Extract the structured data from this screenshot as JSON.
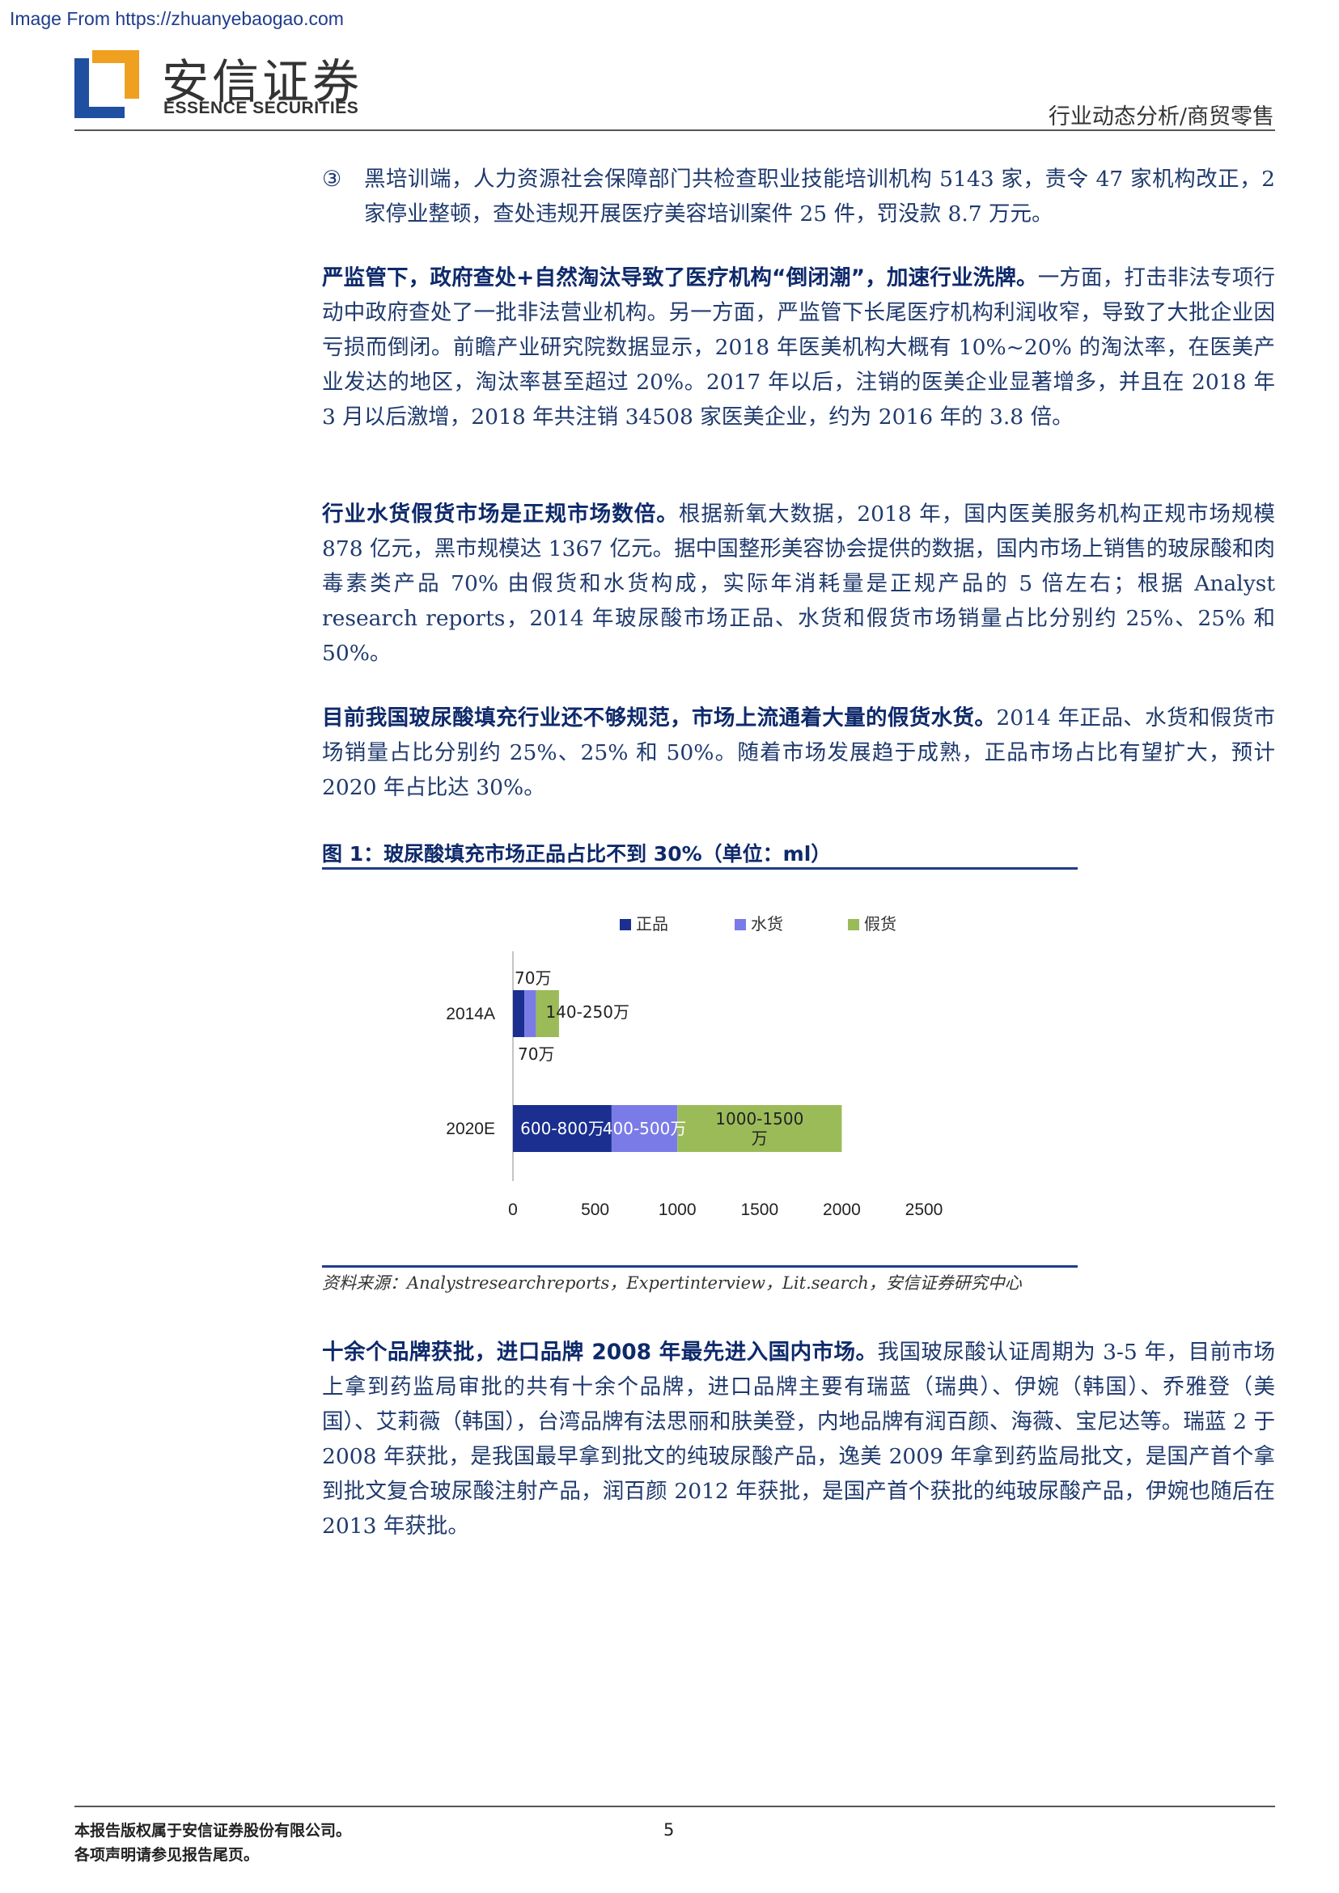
{
  "source_url": "Image From https://zhuanyebaogao.com",
  "brand": {
    "name_cn": "安信证券",
    "name_en": "ESSENCE SECURITIES"
  },
  "header_category": "行业动态分析/商贸零售",
  "bullet": {
    "marker": "③",
    "text": "黑培训端，人力资源社会保障部门共检查职业技能培训机构 5143 家，责令 47 家机构改正，2 家停业整顿，查处违规开展医疗美容培训案件 25 件，罚没款 8.7 万元。"
  },
  "paragraphs": [
    {
      "lead": "严监管下，政府查处+自然淘汰导致了医疗机构“倒闭潮”，加速行业洗牌。",
      "body": "一方面，打击非法专项行动中政府查处了一批非法营业机构。另一方面，严监管下长尾医疗机构利润收窄，导致了大批企业因亏损而倒闭。前瞻产业研究院数据显示，2018 年医美机构大概有 10%~20% 的淘汰率，在医美产业发达的地区，淘汰率甚至超过 20%。2017 年以后，注销的医美企业显著增多，并且在 2018 年 3 月以后激增，2018 年共注销 34508 家医美企业，约为 2016 年的 3.8 倍。"
    },
    {
      "lead": "行业水货假货市场是正规市场数倍。",
      "body": "根据新氧大数据，2018 年，国内医美服务机构正规市场规模 878 亿元，黑市规模达 1367 亿元。据中国整形美容协会提供的数据，国内市场上销售的玻尿酸和肉毒素类产品 70% 由假货和水货构成，实际年消耗量是正规产品的 5 倍左右；根据 Analyst research reports，2014 年玻尿酸市场正品、水货和假货市场销量占比分别约 25%、25% 和 50%。"
    },
    {
      "lead": "目前我国玻尿酸填充行业还不够规范，市场上流通着大量的假货水货。",
      "body": "2014 年正品、水货和假货市场销量占比分别约 25%、25% 和 50%。随着市场发展趋于成熟，正品市场占比有望扩大，预计 2020 年占比达 30%。"
    },
    {
      "lead": "十余个品牌获批，进口品牌 2008 年最先进入国内市场。",
      "body": "我国玻尿酸认证周期为 3-5 年，目前市场上拿到药监局审批的共有十余个品牌，进口品牌主要有瑞蓝（瑞典）、伊婉（韩国）、乔雅登（美国）、艾莉薇（韩国），台湾品牌有法思丽和肤美登，内地品牌有润百颜、海薇、宝尼达等。瑞蓝 2 于 2008 年获批，是我国最早拿到批文的纯玻尿酸产品，逸美 2009 年拿到药监局批文，是国产首个拿到批文复合玻尿酸注射产品，润百颜 2012 年获批，是国产首个获批的纯玻尿酸产品，伊婉也随后在 2013 年获批。"
    }
  ],
  "figure": {
    "title": "图 1：玻尿酸填充市场正品占比不到 30%（单位：ml）",
    "source": "资料来源：Analystresearchreports，Expertinterview，Lit.search，安信证券研究中心"
  },
  "chart_data": {
    "type": "bar",
    "orientation": "horizontal",
    "stacked": true,
    "categories": [
      "2014A",
      "2020E"
    ],
    "series": [
      {
        "name": "正品",
        "color": "#1a2f8f",
        "values": [
          70,
          600
        ],
        "labels": [
          "70万",
          "600-800万"
        ]
      },
      {
        "name": "水货",
        "color": "#7b7be8",
        "values": [
          70,
          400
        ],
        "labels": [
          "70万",
          "400-500万"
        ]
      },
      {
        "name": "假货",
        "color": "#9bbb59",
        "values": [
          140,
          1000
        ],
        "labels": [
          "140-250万",
          "1000-1500万"
        ]
      }
    ],
    "xlim": [
      0,
      2500
    ],
    "xticks": [
      "0",
      "500",
      "1000",
      "1500",
      "2000",
      "2500"
    ],
    "legend_position": "top"
  },
  "footer": {
    "line1": "本报告版权属于安信证券股份有限公司。",
    "line2": "各项声明请参见报告尾页。",
    "page": "5"
  }
}
